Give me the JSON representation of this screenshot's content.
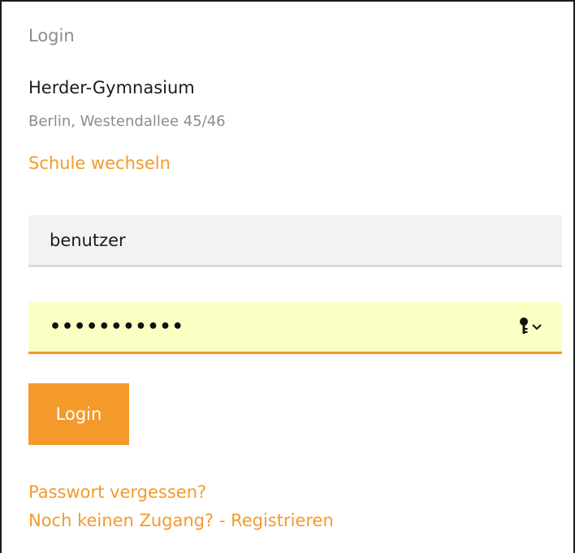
{
  "panel": {
    "title": "Login"
  },
  "school": {
    "name": "Herder-Gymnasium",
    "address": "Berlin, Westendallee 45/46",
    "change_link": "Schule wechseln"
  },
  "form": {
    "username_value": "benutzer",
    "password_value": "•••••••••••",
    "password_manager_icon": "key-icon",
    "dropdown_icon": "chevron-down-icon",
    "submit_label": "Login"
  },
  "links": {
    "forgot_password": "Passwort vergessen?",
    "register": "Noch keinen Zugang? - Registrieren"
  },
  "colors": {
    "accent": "#f39a2b",
    "muted_text": "#8c8c8c",
    "autofill_background": "#fbffc4",
    "input_background": "#f2f2f2"
  }
}
